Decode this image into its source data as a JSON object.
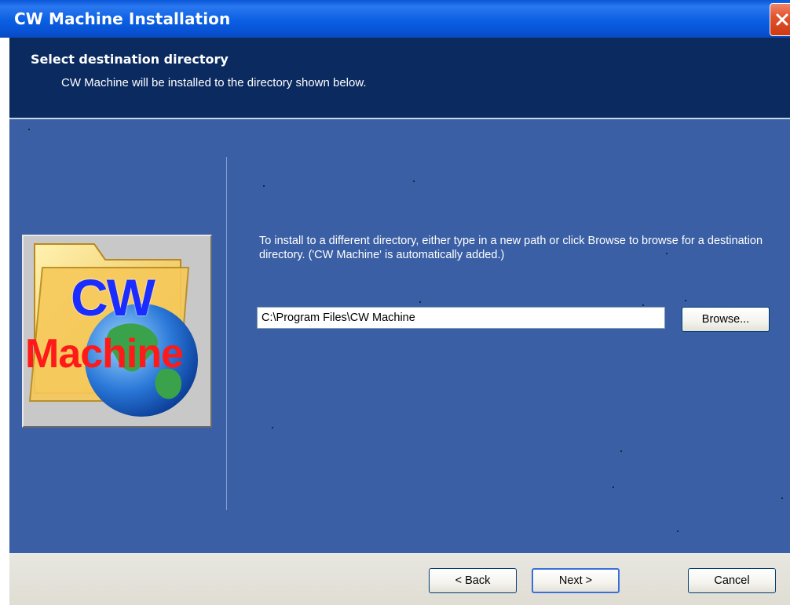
{
  "window": {
    "title": "CW Machine Installation"
  },
  "header": {
    "title": "Select destination directory",
    "description": "CW Machine will be installed to the directory shown below."
  },
  "logo": {
    "line1": "CW",
    "line2": "Machine",
    "icon": "folder-globe-icon"
  },
  "main": {
    "instructions": "To install to a different directory, either type in a new path or click Browse to browse for a destination directory. ('CW Machine' is automatically added.)",
    "path_value": "C:\\Program Files\\CW Machine",
    "browse_label": "Browse..."
  },
  "footer": {
    "back_label": "< Back",
    "next_label": "Next >",
    "cancel_label": "Cancel"
  },
  "colors": {
    "titlebar": "#0b5fe3",
    "header_band": "#0a2a60",
    "panel": "#3a5fa4",
    "footer": "#e2e0d6"
  }
}
